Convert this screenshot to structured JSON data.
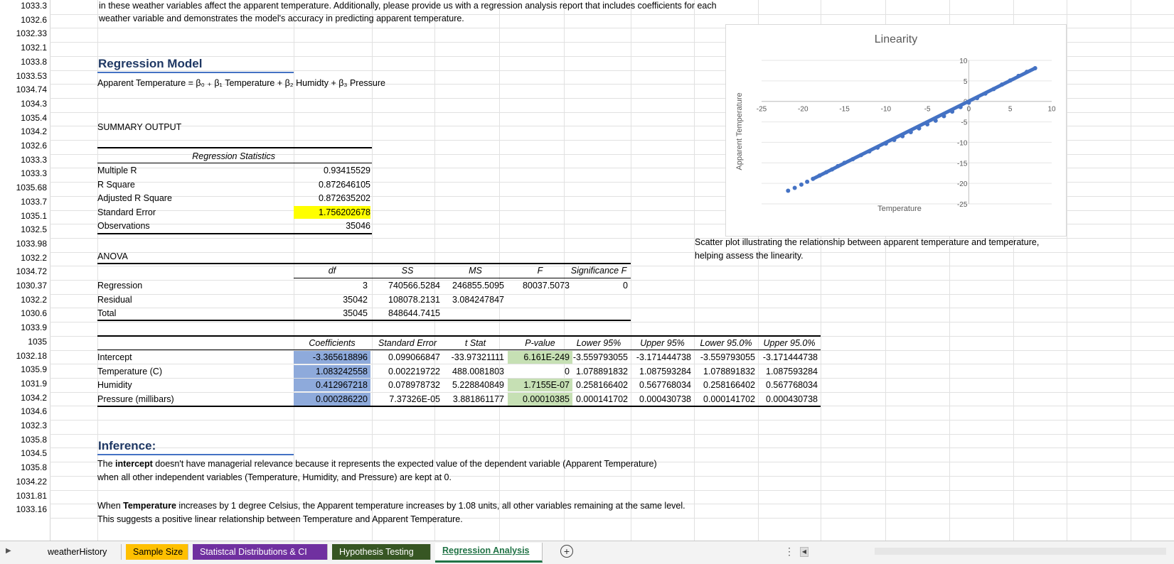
{
  "row_numbers": [
    "1033.3",
    "1032.6",
    "1032.33",
    "1032.1",
    "1033.8",
    "1033.53",
    "1034.74",
    "1034.3",
    "1035.4",
    "1034.2",
    "1032.6",
    "1033.3",
    "1033.3",
    "1035.68",
    "1033.7",
    "1035.1",
    "1032.5",
    "1033.98",
    "1032.2",
    "1034.72",
    "1030.37",
    "1032.2",
    "1030.6",
    "1033.9",
    "1035",
    "1032.18",
    "1035.9",
    "1031.9",
    "1034.2",
    "1034.6",
    "1032.3",
    "1035.8",
    "1034.5",
    "1035.8",
    "1034.22",
    "1031.81",
    "1033.16"
  ],
  "intro": {
    "line1": "in these weather variables affect the apparent temperature. Additionally, please provide us with a regression analysis report that includes coefficients for each",
    "line2": "weather variable and demonstrates the model's accuracy in predicting apparent temperature."
  },
  "model": {
    "heading": "Regression Model",
    "equation": "Apparent Temperature = β₀ ₊ β₁ Temperature + β₂ Humidty + β₃ Pressure"
  },
  "summary": {
    "title": "SUMMARY OUTPUT",
    "stats_header": "Regression Statistics",
    "stats": [
      {
        "label": "Multiple R",
        "value": "0.93415529"
      },
      {
        "label": "R Square",
        "value": "0.872646105"
      },
      {
        "label": "Adjusted R Square",
        "value": "0.872635202"
      },
      {
        "label": "Standard Error",
        "value": "1.756202678"
      },
      {
        "label": "Observations",
        "value": "35046"
      }
    ]
  },
  "anova": {
    "title": "ANOVA",
    "headers": [
      "df",
      "SS",
      "MS",
      "F",
      "Significance F"
    ],
    "rows": [
      {
        "label": "Regression",
        "df": "3",
        "ss": "740566.5284",
        "ms": "246855.5095",
        "f": "80037.5073",
        "sig": "0"
      },
      {
        "label": "Residual",
        "df": "35042",
        "ss": "108078.2131",
        "ms": "3.084247847",
        "f": "",
        "sig": ""
      },
      {
        "label": "Total",
        "df": "35045",
        "ss": "848644.7415",
        "ms": "",
        "f": "",
        "sig": ""
      }
    ]
  },
  "coef": {
    "headers": [
      "Coefficients",
      "Standard Error",
      "t Stat",
      "P-value",
      "Lower 95%",
      "Upper 95%",
      "Lower 95.0%",
      "Upper 95.0%"
    ],
    "rows": [
      {
        "label": "Intercept",
        "vals": [
          "-3.365618896",
          "0.099066847",
          "-33.97321111",
          "6.161E-249",
          "-3.559793055",
          "-3.171444738",
          "-3.559793055",
          "-3.171444738"
        ]
      },
      {
        "label": "Temperature (C)",
        "vals": [
          "1.083242558",
          "0.002219722",
          "488.0081803",
          "0",
          "1.078891832",
          "1.087593284",
          "1.078891832",
          "1.087593284"
        ]
      },
      {
        "label": "Humidity",
        "vals": [
          "0.412967218",
          "0.078978732",
          "5.228840849",
          "1.7155E-07",
          "0.258166402",
          "0.567768034",
          "0.258166402",
          "0.567768034"
        ]
      },
      {
        "label": "Pressure (millibars)",
        "vals": [
          "0.000286220",
          "7.37326E-05",
          "3.881861177",
          "0.00010385",
          "0.000141702",
          "0.000430738",
          "0.000141702",
          "0.000430738"
        ]
      }
    ]
  },
  "inference": {
    "heading": "Inference:",
    "p1_pre": "The ",
    "p1_bold": "intercept",
    "p1_post": " doesn't have managerial relevance because it represents the expected value of the dependent variable (Apparent Temperature)",
    "p1_line2": "when all other independent variables (Temperature, Humidity, and Pressure) are kept at 0.",
    "p2_pre": "When ",
    "p2_bold": "Temperature",
    "p2_post": " increases by 1 degree Celsius, the Apparent temperature increases by 1.08 units, all other variables remaining at the same level.",
    "p2_line2": "This suggests a positive linear relationship between Temperature and Apparent Temperature."
  },
  "chart_caption": {
    "line1": "Scatter plot illustrating the relationship between apparent temperature and temperature,",
    "line2": "helping assess the linearity."
  },
  "chart_data": {
    "type": "scatter",
    "title": "Linearity",
    "xlabel": "Temperature",
    "ylabel": "Apparent Temperature",
    "xlim": [
      -25,
      10
    ],
    "ylim": [
      -25,
      10
    ],
    "xticks": [
      "-25",
      "-20",
      "-15",
      "-10",
      "-5",
      "0",
      "5",
      "10"
    ],
    "yticks": [
      "10",
      "5",
      "0",
      "-5",
      "-10",
      "-15",
      "-20",
      "-25"
    ],
    "series": [
      {
        "color": "#4472c4",
        "x": [
          -21.8,
          -21.0,
          -20.2,
          -19.5,
          -18.8,
          -18.0,
          -17.2,
          -16.5,
          -15.8,
          -15.0,
          -14.0,
          -13.0,
          -12.0,
          -11.0,
          -10.0,
          -9.0,
          -8.0,
          -7.0,
          -6.0,
          -5.0,
          -4.0,
          -3.0,
          -2.0,
          -1.0,
          0.0,
          1.0,
          2.0,
          3.0,
          4.0,
          5.0,
          6.0,
          7.0,
          8.0
        ],
        "y": [
          -21.8,
          -21.1,
          -20.3,
          -19.6,
          -18.9,
          -18.1,
          -17.3,
          -16.6,
          -15.8,
          -15.0,
          -14.1,
          -13.1,
          -12.2,
          -11.3,
          -10.3,
          -9.4,
          -8.5,
          -7.5,
          -6.6,
          -5.6,
          -4.7,
          -3.6,
          -2.5,
          -1.4,
          -0.3,
          0.8,
          1.9,
          3.0,
          4.1,
          5.1,
          6.2,
          7.2,
          8.1
        ]
      }
    ]
  },
  "tabs": [
    {
      "label": "weatherHistory",
      "color": "#f3f3f3",
      "active": false
    },
    {
      "label": "Sample Size",
      "color": "#ffc000",
      "active": false
    },
    {
      "label": "Statistcal Distributions & CI",
      "color": "#7030a0",
      "active": false
    },
    {
      "label": "Hypothesis Testing",
      "color": "#375623",
      "active": false
    },
    {
      "label": "Regression Analysis",
      "color": "#ffffff",
      "active": true
    }
  ],
  "colors": {
    "coef_fill": "#8eaadb",
    "pvalue_fill": "#c6e0b4",
    "std_error_fill": "#ffff00",
    "heading": "#1f3864",
    "accent": "#4472c4"
  }
}
